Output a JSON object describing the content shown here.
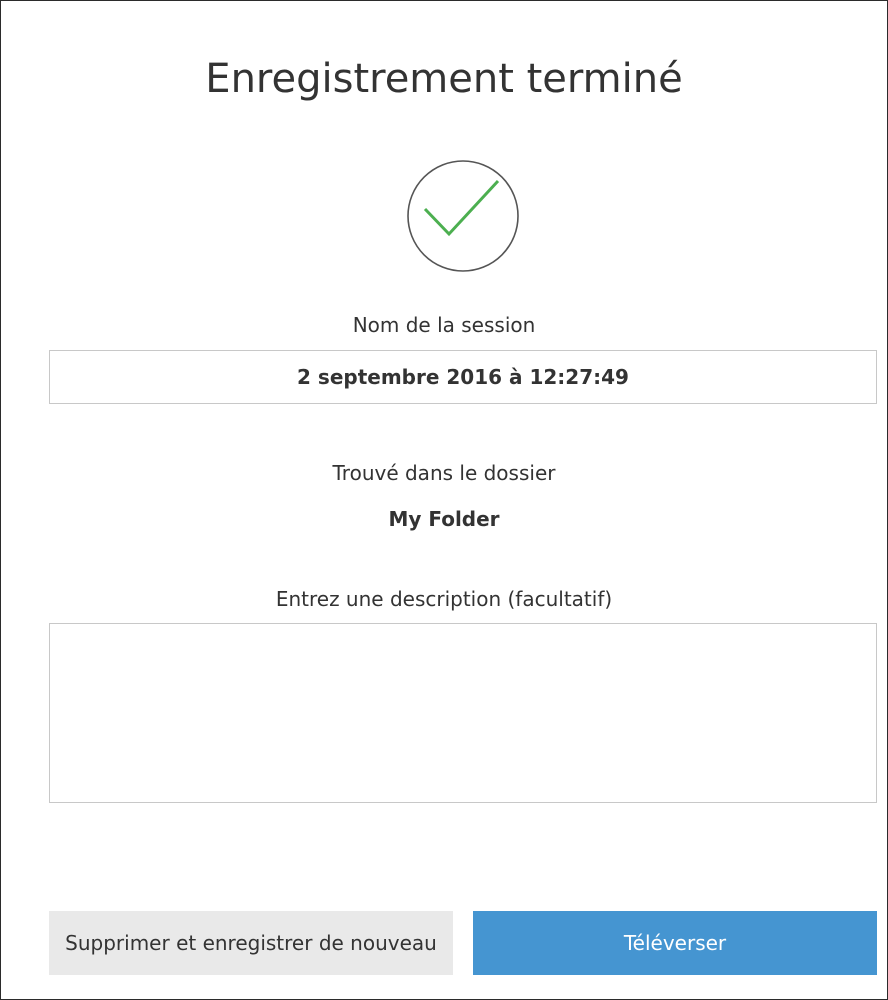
{
  "dialog": {
    "title": "Enregistrement terminé",
    "success_icon": "check-circle-icon",
    "accent_color": "#4caf50",
    "session": {
      "label": "Nom de la session",
      "value": "2 septembre 2016 à 12:27:49"
    },
    "folder": {
      "label": "Trouvé dans le dossier",
      "name": "My Folder"
    },
    "description": {
      "label": "Entrez une description (facultatif)",
      "value": ""
    },
    "buttons": {
      "delete_label": "Supprimer et enregistrer de nouveau",
      "upload_label": "Téléverser",
      "upload_color": "#4595d1"
    }
  }
}
